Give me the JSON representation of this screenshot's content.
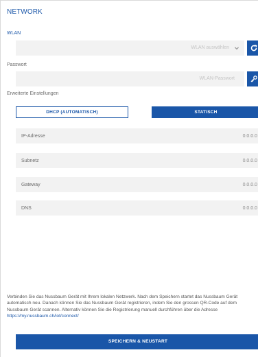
{
  "header": {
    "title": "NETWORK"
  },
  "wlan": {
    "label": "WLAN",
    "select_value": "WLAN auswählen",
    "refresh_icon": "refresh-icon",
    "chevron_icon": "chevron-down-icon"
  },
  "password": {
    "label": "Passwort",
    "placeholder": "WLAN-Passwort",
    "key_icon": "key-icon"
  },
  "advanced": {
    "label": "Erweiterte Einstellungen"
  },
  "mode": {
    "dhcp_label": "DHCP (AUTOMATISCH)",
    "static_label": "STATISCH",
    "selected": "STATISCH"
  },
  "static_fields": [
    {
      "label": "IP-Adresse",
      "value": "0.0.0.0"
    },
    {
      "label": "Subnetz",
      "value": "0.0.0.0"
    },
    {
      "label": "Gateway",
      "value": "0.0.0.0"
    },
    {
      "label": "DNS",
      "value": "0.0.0.0"
    }
  ],
  "info": {
    "text": "Verbinden Sie das Nussbaum Gerät mit Ihrem lokalen Netzwerk. Nach dem Speichern startet das Nussbaum Gerät automatisch neu. Danach können Sie das Nussbaum Gerät registrieren, indem Sie den grossen QR-Code auf dem Nussbaum Gerät scannen. Alternativ können Sie die Registrierung manuell durchführen über die Adresse",
    "link": "https://my.nussbaum.ch/iot/connect/"
  },
  "footer": {
    "save_label": "SPEICHERN & NEUSTART"
  },
  "colors": {
    "accent": "#1a56a8",
    "field_bg": "#f2f2f2",
    "text_muted": "#6a6a6a"
  }
}
